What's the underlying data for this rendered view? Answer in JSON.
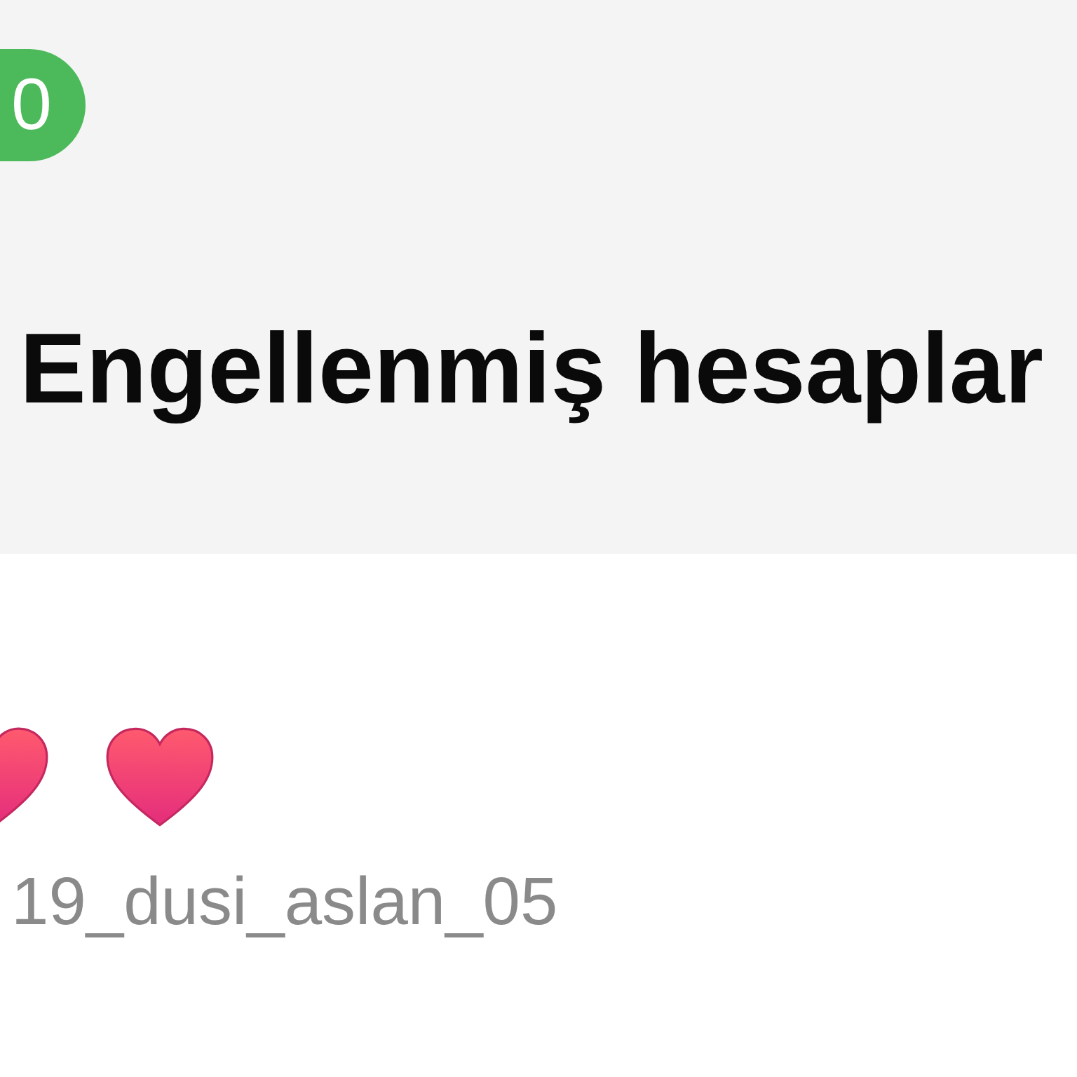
{
  "status_badge": {
    "text": "0"
  },
  "header": {
    "title": "Engellenmiş hesaplar"
  },
  "account": {
    "username": "19_dusi_aslan_05"
  }
}
